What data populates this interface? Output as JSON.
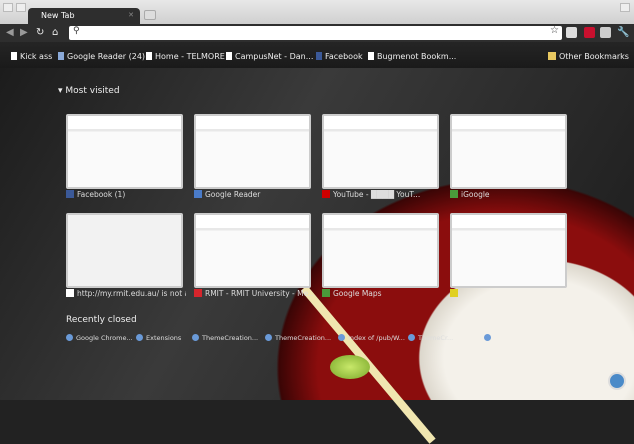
{
  "tab": {
    "title": "New Tab"
  },
  "omnibox": {
    "value": ""
  },
  "bookmarks": [
    {
      "label": "Kick ass",
      "icon": "page-icon"
    },
    {
      "label": "Google Reader (24)",
      "icon": "reader-icon"
    },
    {
      "label": "Home - TELMORE",
      "icon": "page-icon"
    },
    {
      "label": "CampusNet - Dan...",
      "icon": "page-icon"
    },
    {
      "label": "Facebook",
      "icon": "facebook-icon"
    },
    {
      "label": "Bugmenot Bookm...",
      "icon": "page-icon"
    }
  ],
  "other_bookmarks": "Other Bookmarks",
  "most_visited": {
    "heading": "Most visited",
    "items": [
      {
        "title": "Facebook (1)",
        "color": "#3b5998"
      },
      {
        "title": "Google Reader",
        "color": "#4a7bc8"
      },
      {
        "title": "YouTube - ████ YouT...",
        "color": "#cc0000"
      },
      {
        "title": "iGoogle",
        "color": "#4a9a3a"
      },
      {
        "title": "http://my.rmit.edu.au/ is not a...",
        "color": "#ffffff"
      },
      {
        "title": "RMIT - RMIT University - Me...",
        "color": "#d6252c"
      },
      {
        "title": "Google Maps",
        "color": "#4a9a3a"
      },
      {
        "title": "",
        "color": "#e0d020"
      }
    ]
  },
  "recently_closed": {
    "heading": "Recently closed",
    "items": [
      "Google Chrome...",
      "Extensions",
      "ThemeCreation...",
      "ThemeCreation...",
      "Index of /pub/W...",
      "ThemeCr...",
      ""
    ]
  }
}
